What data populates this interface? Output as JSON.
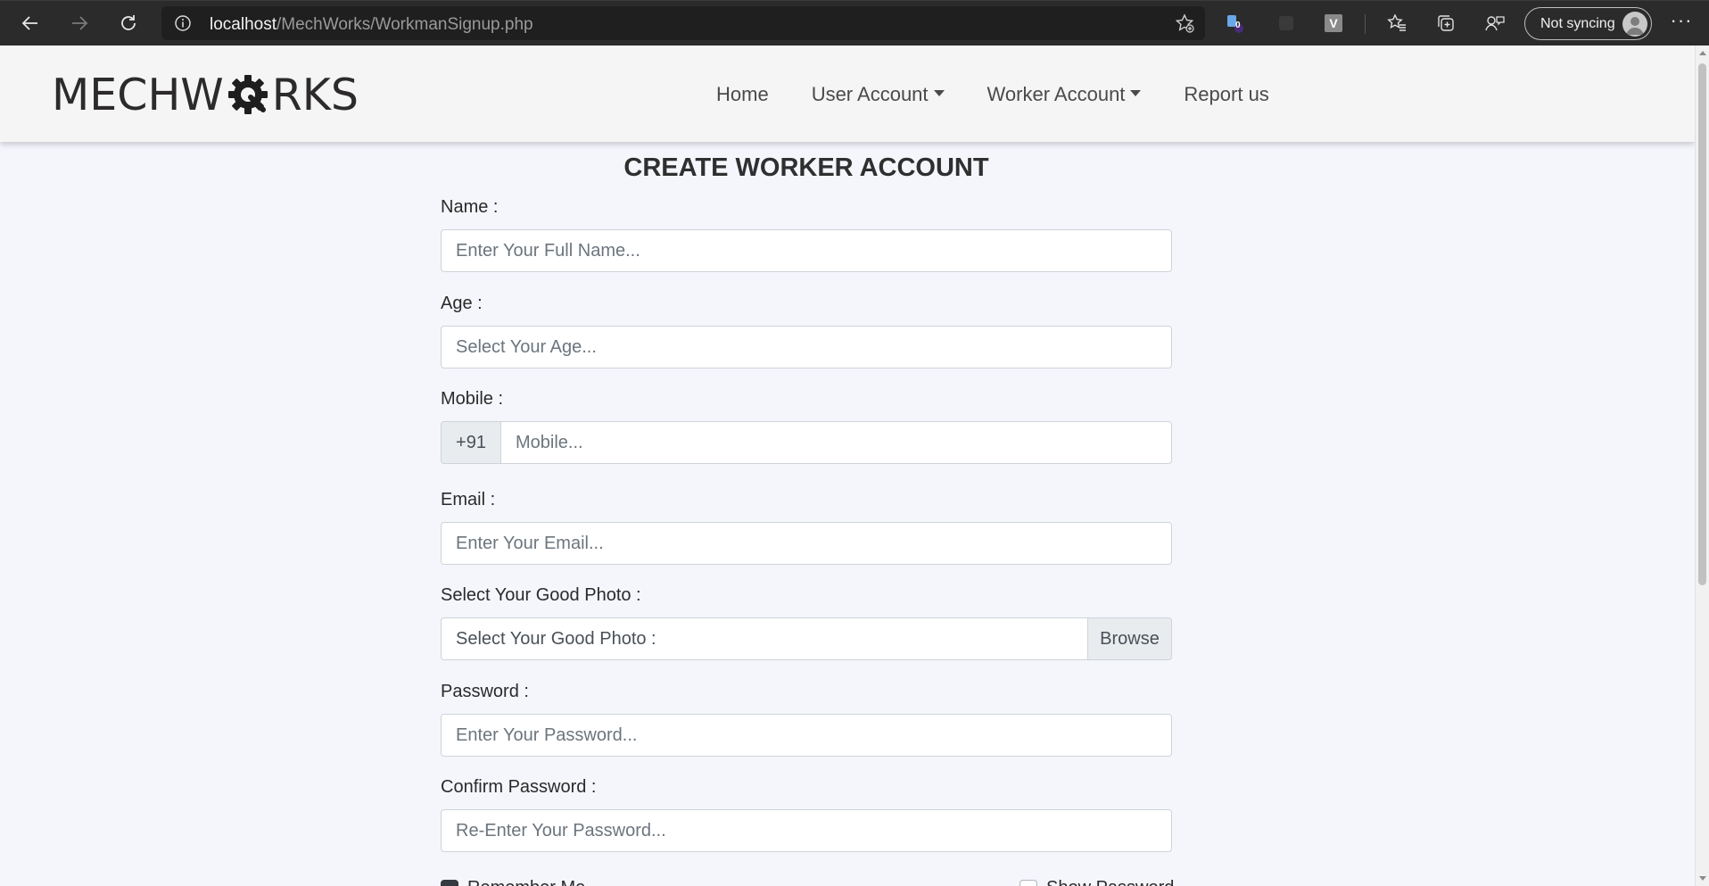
{
  "browser": {
    "url_host": "localhost",
    "url_path": "/MechWorks/WorkmanSignup.php",
    "sync_label": "Not syncing",
    "extension_badge": "0",
    "extension_letter": "V"
  },
  "site": {
    "logo_left": "MECHW",
    "logo_right": "RKS",
    "nav": [
      {
        "label": "Home"
      },
      {
        "label": "User Account"
      },
      {
        "label": "Worker Account"
      },
      {
        "label": "Report us"
      }
    ]
  },
  "form": {
    "title": "CREATE WORKER ACCOUNT",
    "name": {
      "label": "Name :",
      "placeholder": "Enter Your Full Name..."
    },
    "age": {
      "label": "Age :",
      "placeholder": "Select Your Age..."
    },
    "mobile": {
      "label": "Mobile :",
      "prefix": "+91",
      "placeholder": "Mobile..."
    },
    "email": {
      "label": "Email :",
      "placeholder": "Enter Your Email..."
    },
    "photo": {
      "label": "Select Your Good Photo :",
      "placeholder": "Select Your Good Photo :",
      "button": "Browse"
    },
    "password": {
      "label": "Password :",
      "placeholder": "Enter Your Password..."
    },
    "confirm": {
      "label": "Confirm Password :",
      "placeholder": "Re-Enter Your Password..."
    },
    "remember_label": "Remember Me",
    "show_password_label": "Show Password"
  },
  "colors": {
    "chrome_bg": "#2b2b2b",
    "navbar_bg": "#f5f5f5",
    "page_bg": "#f4f6fc"
  }
}
